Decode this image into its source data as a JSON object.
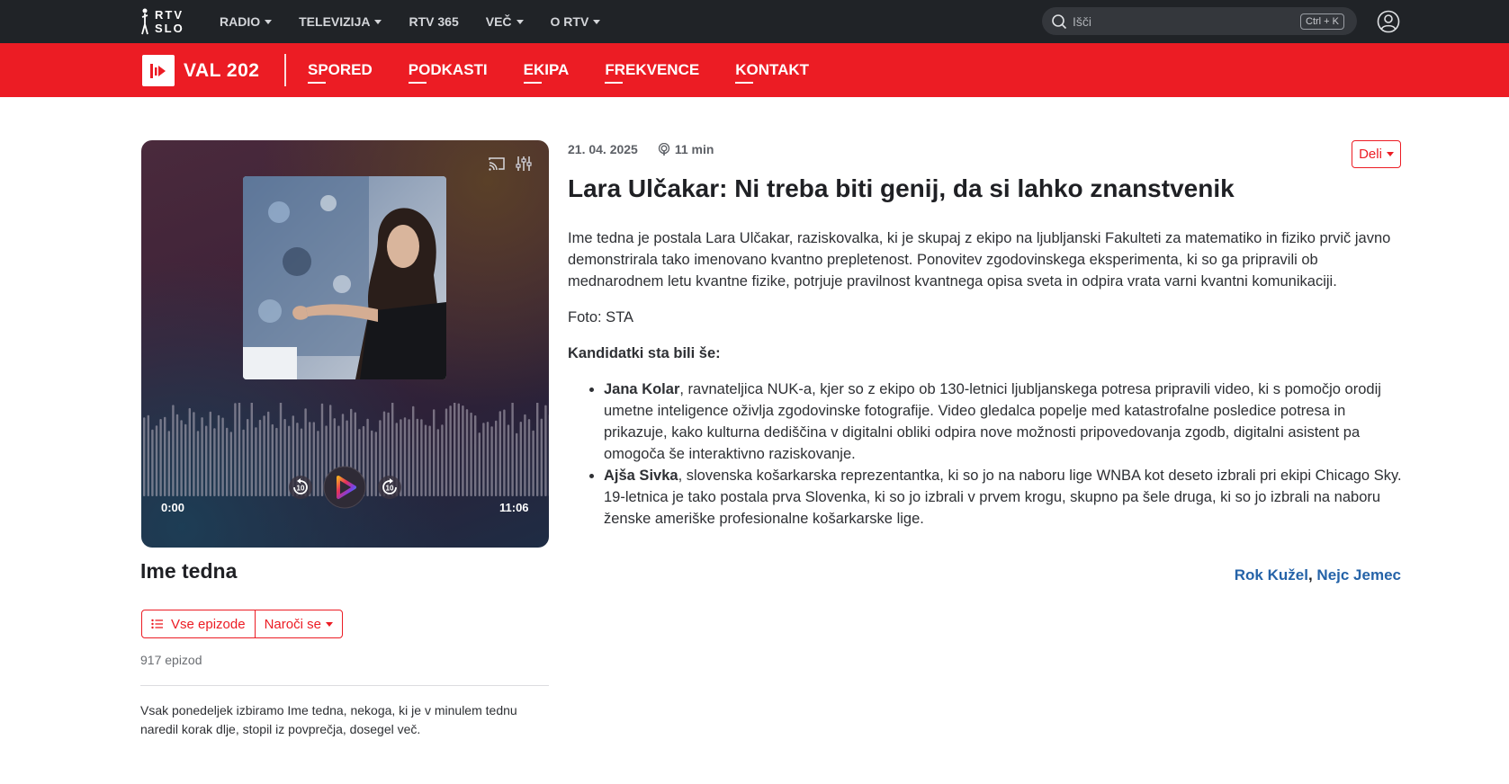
{
  "header": {
    "logo_line1": "RTV",
    "logo_line2": "SLO",
    "nav": [
      {
        "label": "RADIO",
        "dropdown": true
      },
      {
        "label": "TELEVIZIJA",
        "dropdown": true
      },
      {
        "label": "RTV 365",
        "dropdown": false
      },
      {
        "label": "VEČ",
        "dropdown": true
      },
      {
        "label": "O RTV",
        "dropdown": true
      }
    ],
    "search_placeholder": "Išči",
    "search_shortcut": "Ctrl + K"
  },
  "station": {
    "name": "VAL 202",
    "nav": [
      "SPORED",
      "PODKASTI",
      "EKIPA",
      "FREKVENCE",
      "KONTAKT"
    ]
  },
  "player": {
    "current_time": "0:00",
    "duration": "11:06",
    "skip_back_seconds": "10",
    "skip_forward_seconds": "10"
  },
  "show": {
    "title": "Ime tedna",
    "all_episodes_label": "Vse epizode",
    "subscribe_label": "Naroči se",
    "episode_count": "917 epizod",
    "description": "Vsak ponedeljek izbiramo Ime tedna, nekoga, ki je v minulem tednu naredil korak dlje, stopil iz povprečja, dosegel več."
  },
  "article": {
    "date": "21. 04. 2025",
    "duration": "11 min",
    "share_label": "Deli",
    "title": "Lara Ulčakar: Ni treba biti genij, da si lahko znanstvenik",
    "lead": "Ime tedna je postala Lara Ulčakar, raziskovalka, ki je skupaj z ekipo na ljubljanski Fakulteti za matematiko in fiziko prvič javno demonstrirala tako imenovano kvantno prepletenost. Ponovitev zgodovinskega eksperimenta, ki so ga pripravili ob mednarodnem letu kvantne fizike, potrjuje pravilnost kvantnega opisa sveta in odpira vrata varni kvantni komunikaciji.",
    "photo_credit": "Foto: STA",
    "candidates_heading": "Kandidatki sta bili še:",
    "candidates": [
      {
        "name": "Jana Kolar",
        "text": ", ravnateljica NUK-a, kjer so z ekipo ob 130-letnici ljubljanskega potresa pripravili video, ki s pomočjo orodij umetne inteligence oživlja zgodovinske fotografije. Video gledalca popelje med katastrofalne posledice potresa in prikazuje, kako kulturna dediščina v digitalni obliki odpira nove možnosti pripovedovanja zgodb, digitalni asistent pa omogoča še interaktivno raziskovanje."
      },
      {
        "name": "Ajša Sivka",
        "text": ", slovenska košarkarska reprezentantka, ki so jo na naboru lige WNBA kot deseto izbrali pri ekipi Chicago Sky. 19-letnica je tako postala prva Slovenka, ki so jo izbrali v prvem krogu, skupno pa šele druga, ki so jo izbrali na naboru ženske ameriške profesionalne košarkarske lige."
      }
    ],
    "authors": [
      "Rok Kužel",
      "Nejc Jemec"
    ],
    "author_separator": ","
  },
  "colors": {
    "brand_red": "#ec1c24",
    "topbar": "#202327",
    "link_blue": "#2563a8"
  }
}
